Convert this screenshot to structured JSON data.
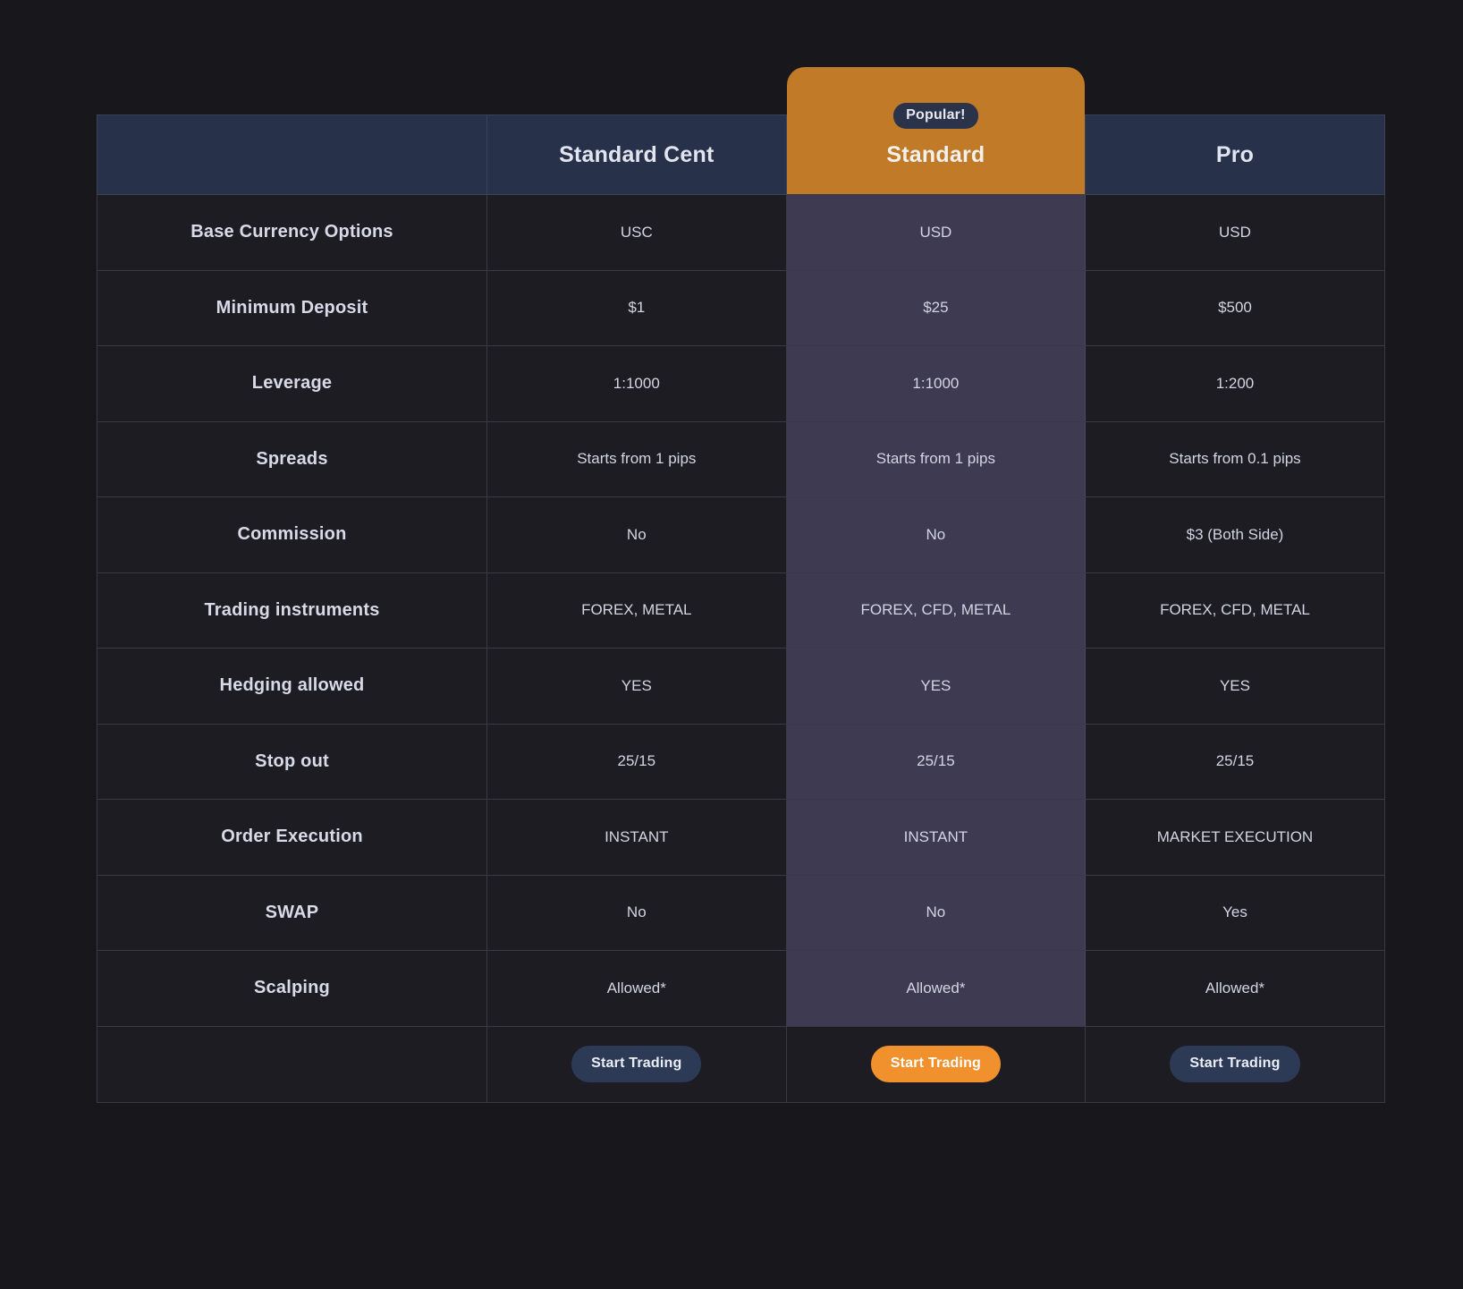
{
  "table": {
    "columns": [
      {
        "id": "label",
        "label": "",
        "highlight": false
      },
      {
        "id": "standard_cent",
        "label": "Standard Cent",
        "highlight": false
      },
      {
        "id": "standard",
        "label": "Standard",
        "highlight": true
      },
      {
        "id": "pro",
        "label": "Pro",
        "highlight": false
      }
    ],
    "popular_badge": "Popular!",
    "rows": [
      {
        "label": "Base Currency Options",
        "standard_cent": "USC",
        "standard": "USD",
        "pro": "USD"
      },
      {
        "label": "Minimum Deposit",
        "standard_cent": "$1",
        "standard": "$25",
        "pro": "$500"
      },
      {
        "label": "Leverage",
        "standard_cent": "1:1000",
        "standard": "1:1000",
        "pro": "1:200"
      },
      {
        "label": "Spreads",
        "standard_cent": "Starts from 1 pips",
        "standard": "Starts from 1 pips",
        "pro": "Starts from 0.1 pips"
      },
      {
        "label": "Commission",
        "standard_cent": "No",
        "standard": "No",
        "pro": "$3 (Both Side)"
      },
      {
        "label": "Trading instruments",
        "standard_cent": "FOREX, METAL",
        "standard": "FOREX, CFD, METAL",
        "pro": "FOREX, CFD, METAL"
      },
      {
        "label": "Hedging allowed",
        "standard_cent": "YES",
        "standard": "YES",
        "pro": "YES"
      },
      {
        "label": "Stop out",
        "standard_cent": "25/15",
        "standard": "25/15",
        "pro": "25/15"
      },
      {
        "label": "Order Execution",
        "standard_cent": "INSTANT",
        "standard": "INSTANT",
        "pro": "MARKET EXECUTION"
      },
      {
        "label": "SWAP",
        "standard_cent": "No",
        "standard": "No",
        "pro": "Yes"
      },
      {
        "label": "Scalping",
        "standard_cent": "Allowed*",
        "standard": "Allowed*",
        "pro": "Allowed*"
      }
    ],
    "cta": {
      "label": "",
      "standard_cent": "Start Trading",
      "standard": "Start Trading",
      "pro": "Start Trading"
    }
  },
  "colors": {
    "page_background": "#17171c",
    "header_background": "#27314a",
    "highlight_column": "#3e3a52",
    "popular_card": "#c07a28",
    "badge_background": "#2a3349",
    "cell_background": "#1c1c22",
    "border": "#3a3a45",
    "button_default": "#2c3a56",
    "button_primary": "#f0912e"
  }
}
